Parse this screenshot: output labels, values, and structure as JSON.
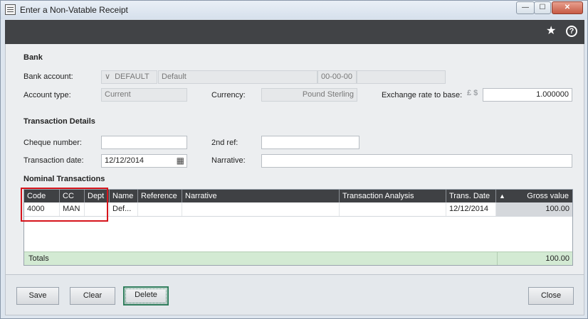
{
  "window": {
    "title": "Enter a Non-Vatable Receipt",
    "min_glyph": "—",
    "max_glyph": "☐",
    "close_glyph": "✕"
  },
  "header": {
    "favorite_icon": "star-icon",
    "favorite_glyph": "★",
    "help_icon": "help-icon",
    "help_glyph": "?"
  },
  "bank": {
    "section_title": "Bank",
    "account_label": "Bank account:",
    "account_code": "DEFAULT",
    "account_dropdown_glyph": "∨",
    "account_name": "Default",
    "sort_code": "00-00-00",
    "account_number": "",
    "account_type_label": "Account type:",
    "account_type": "Current",
    "currency_label": "Currency:",
    "currency": "Pound Sterling",
    "exchange_label": "Exchange rate to base:",
    "exchange_symbols": "£ $",
    "exchange_rate": "1.000000"
  },
  "transaction": {
    "section_title": "Transaction Details",
    "cheque_label": "Cheque number:",
    "cheque_value": "",
    "second_ref_label": "2nd ref:",
    "second_ref_value": "",
    "date_label": "Transaction date:",
    "date_value": "12/12/2014",
    "calendar_glyph": "▦",
    "narrative_label": "Narrative:",
    "narrative_value": ""
  },
  "nominal": {
    "section_title": "Nominal Transactions",
    "columns": {
      "code": "Code",
      "cc": "CC",
      "dept": "Dept",
      "name": "Name",
      "reference": "Reference",
      "narrative": "Narrative",
      "analysis": "Transaction Analysis",
      "date": "Trans. Date",
      "sort_glyph": "▲",
      "gross": "Gross value"
    },
    "rows": [
      {
        "code": "4000",
        "cc": "MAN",
        "dept": "",
        "name": "Def...",
        "reference": "",
        "narrative": "",
        "analysis": "",
        "date": "12/12/2014",
        "gross": "100.00"
      }
    ],
    "totals_label": "Totals",
    "totals_value": "100.00"
  },
  "footer": {
    "save": "Save",
    "clear": "Clear",
    "delete": "Delete",
    "close": "Close"
  },
  "colors": {
    "header_bar": "#414346",
    "totals_row": "#d3ead3",
    "highlight_box": "#d6141c",
    "focused_button": "#2e7d5b"
  }
}
